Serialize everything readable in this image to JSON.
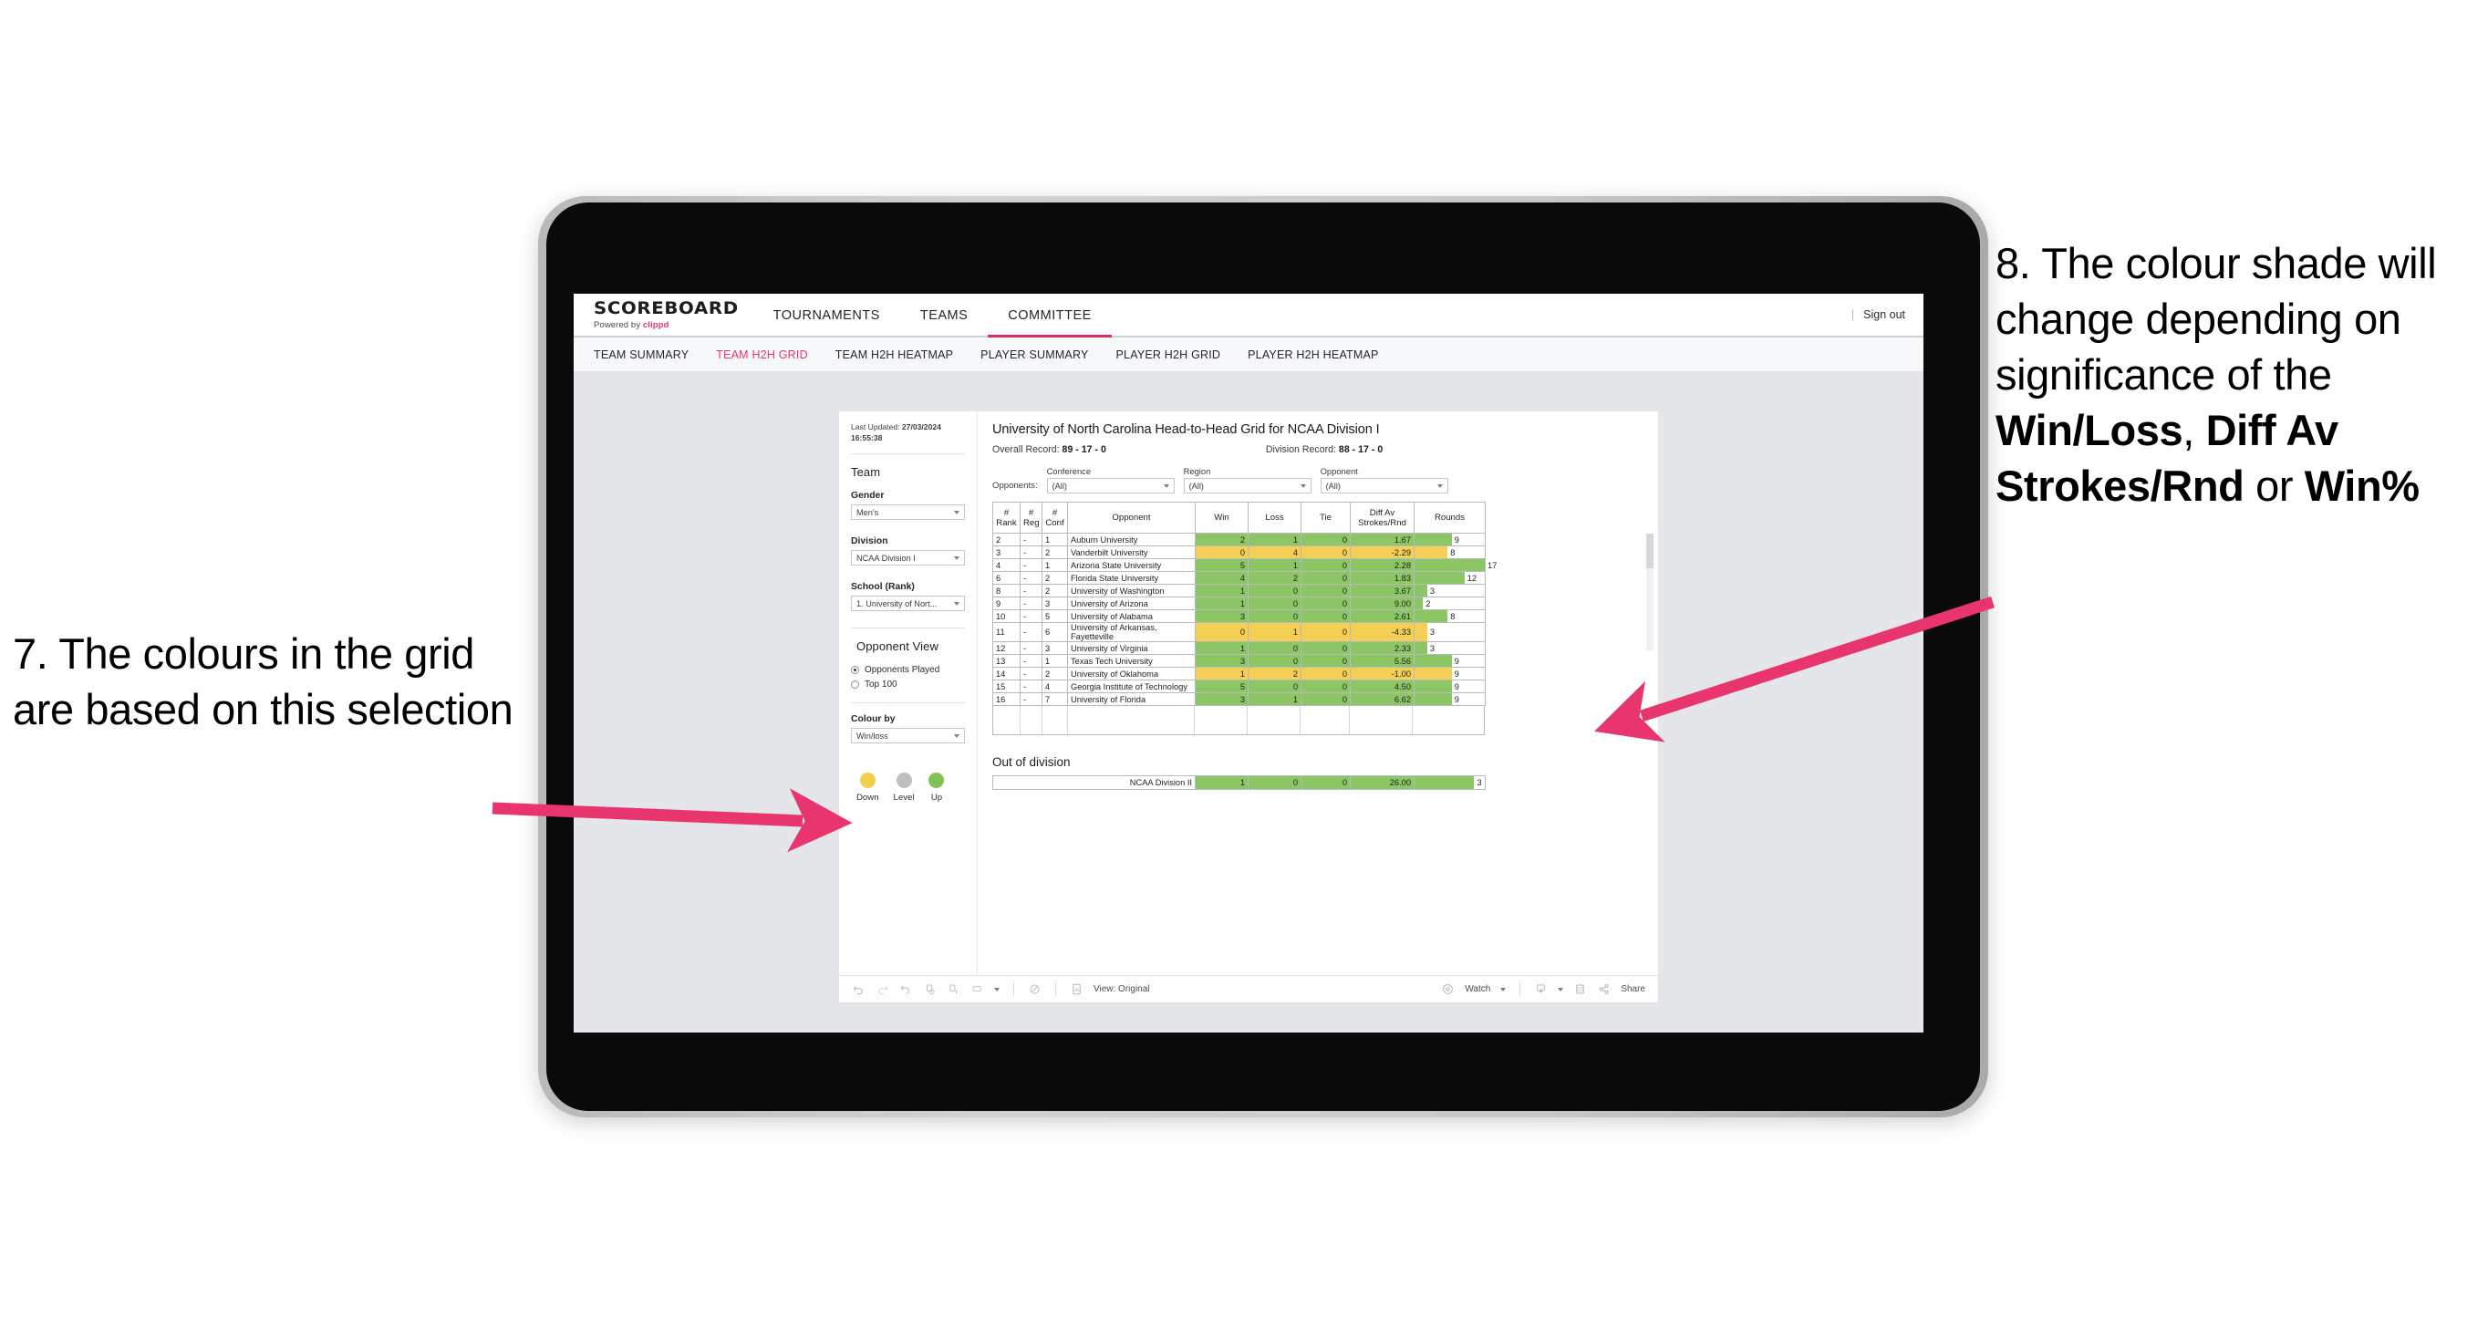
{
  "annotations": {
    "left": "7. The colours in the grid are based on this selection",
    "right_pre": "8. The colour shade will change depending on significance of the ",
    "right_b1": "Win/Loss",
    "right_mid1": ", ",
    "right_b2": "Diff Av Strokes/Rnd",
    "right_mid2": " or ",
    "right_b3": "Win%",
    "arrow_color": "#e8356d"
  },
  "app": {
    "brand": {
      "title": "SCOREBOARD",
      "powered_prefix": "Powered by ",
      "powered_brand": "clippd"
    },
    "topnav": [
      {
        "label": "TOURNAMENTS",
        "active": false
      },
      {
        "label": "TEAMS",
        "active": false
      },
      {
        "label": "COMMITTEE",
        "active": true
      }
    ],
    "topbar_right": {
      "divider": "|",
      "signout": "Sign out"
    },
    "subnav": [
      {
        "label": "TEAM SUMMARY",
        "active": false
      },
      {
        "label": "TEAM H2H GRID",
        "active": true
      },
      {
        "label": "TEAM H2H HEATMAP",
        "active": false
      },
      {
        "label": "PLAYER SUMMARY",
        "active": false
      },
      {
        "label": "PLAYER H2H GRID",
        "active": false
      },
      {
        "label": "PLAYER H2H HEATMAP",
        "active": false
      }
    ],
    "accent": "#e5376f"
  },
  "sidebar": {
    "last_updated_label": "Last Updated: ",
    "last_updated_value": "27/03/2024 16:55:38",
    "team_heading": "Team",
    "gender": {
      "label": "Gender",
      "value": "Men's"
    },
    "division": {
      "label": "Division",
      "value": "NCAA Division I"
    },
    "school": {
      "label": "School (Rank)",
      "value": "1. University of Nort..."
    },
    "opponent_view": {
      "heading": "Opponent View",
      "options": [
        {
          "label": "Opponents Played",
          "selected": true
        },
        {
          "label": "Top 100",
          "selected": false
        }
      ]
    },
    "colour_by": {
      "label": "Colour by",
      "value": "Win/loss"
    },
    "legend": [
      {
        "label": "Down",
        "color": "#f2cf4a"
      },
      {
        "label": "Level",
        "color": "#bdbec2"
      },
      {
        "label": "Up",
        "color": "#81c254"
      }
    ]
  },
  "main": {
    "title": "University of North Carolina Head-to-Head Grid for NCAA Division I",
    "overall_label": "Overall Record: ",
    "overall_value": "89 - 17 - 0",
    "division_label": "Division Record: ",
    "division_value": "88 - 17 - 0",
    "opponents_label": "Opponents:",
    "filters": [
      {
        "label": "Conference",
        "value": "(All)"
      },
      {
        "label": "Region",
        "value": "(All)"
      },
      {
        "label": "Opponent",
        "value": "(All)"
      }
    ],
    "out_of_division_title": "Out of division"
  },
  "chart_data": {
    "type": "table",
    "title": "University of North Carolina Head-to-Head Grid for NCAA Division I",
    "columns": [
      "# Rank",
      "# Reg",
      "# Conf",
      "Opponent",
      "Win",
      "Loss",
      "Tie",
      "Diff Av Strokes/Rnd",
      "Rounds"
    ],
    "column_headers_two_line": [
      [
        "#",
        "Rank"
      ],
      [
        "#",
        "Reg"
      ],
      [
        "#",
        "Conf"
      ],
      [
        "",
        "Opponent"
      ],
      [
        "",
        "Win"
      ],
      [
        "",
        "Loss"
      ],
      [
        "",
        "Tie"
      ],
      [
        "Diff Av",
        "Strokes/Rnd"
      ],
      [
        "",
        "Rounds"
      ]
    ],
    "rows": [
      {
        "rank": "2",
        "reg": "-",
        "conf": "1",
        "opponent": "Auburn University",
        "win": "2",
        "loss": "1",
        "tie": "0",
        "diff": "1.67",
        "rounds": "9",
        "rounds_pct": 53,
        "shade": "up"
      },
      {
        "rank": "3",
        "reg": "-",
        "conf": "2",
        "opponent": "Vanderbilt University",
        "win": "0",
        "loss": "4",
        "tie": "0",
        "diff": "-2.29",
        "rounds": "8",
        "rounds_pct": 47,
        "shade": "down"
      },
      {
        "rank": "4",
        "reg": "-",
        "conf": "1",
        "opponent": "Arizona State University",
        "win": "5",
        "loss": "1",
        "tie": "0",
        "diff": "2.28",
        "rounds": "17",
        "rounds_pct": 100,
        "shade": "up"
      },
      {
        "rank": "6",
        "reg": "-",
        "conf": "2",
        "opponent": "Florida State University",
        "win": "4",
        "loss": "2",
        "tie": "0",
        "diff": "1.83",
        "rounds": "12",
        "rounds_pct": 71,
        "shade": "up"
      },
      {
        "rank": "8",
        "reg": "-",
        "conf": "2",
        "opponent": "University of Washington",
        "win": "1",
        "loss": "0",
        "tie": "0",
        "diff": "3.67",
        "rounds": "3",
        "rounds_pct": 18,
        "shade": "up"
      },
      {
        "rank": "9",
        "reg": "-",
        "conf": "3",
        "opponent": "University of Arizona",
        "win": "1",
        "loss": "0",
        "tie": "0",
        "diff": "9.00",
        "rounds": "2",
        "rounds_pct": 12,
        "shade": "up"
      },
      {
        "rank": "10",
        "reg": "-",
        "conf": "5",
        "opponent": "University of Alabama",
        "win": "3",
        "loss": "0",
        "tie": "0",
        "diff": "2.61",
        "rounds": "8",
        "rounds_pct": 47,
        "shade": "up"
      },
      {
        "rank": "11",
        "reg": "-",
        "conf": "6",
        "opponent": "University of Arkansas, Fayetteville",
        "win": "0",
        "loss": "1",
        "tie": "0",
        "diff": "-4.33",
        "rounds": "3",
        "rounds_pct": 18,
        "shade": "down"
      },
      {
        "rank": "12",
        "reg": "-",
        "conf": "3",
        "opponent": "University of Virginia",
        "win": "1",
        "loss": "0",
        "tie": "0",
        "diff": "2.33",
        "rounds": "3",
        "rounds_pct": 18,
        "shade": "up"
      },
      {
        "rank": "13",
        "reg": "-",
        "conf": "1",
        "opponent": "Texas Tech University",
        "win": "3",
        "loss": "0",
        "tie": "0",
        "diff": "5.56",
        "rounds": "9",
        "rounds_pct": 53,
        "shade": "up"
      },
      {
        "rank": "14",
        "reg": "-",
        "conf": "2",
        "opponent": "University of Oklahoma",
        "win": "1",
        "loss": "2",
        "tie": "0",
        "diff": "-1.00",
        "rounds": "9",
        "rounds_pct": 53,
        "shade": "down"
      },
      {
        "rank": "15",
        "reg": "-",
        "conf": "4",
        "opponent": "Georgia Institute of Technology",
        "win": "5",
        "loss": "0",
        "tie": "0",
        "diff": "4.50",
        "rounds": "9",
        "rounds_pct": 53,
        "shade": "up"
      },
      {
        "rank": "16",
        "reg": "-",
        "conf": "7",
        "opponent": "University of Florida",
        "win": "3",
        "loss": "1",
        "tie": "0",
        "diff": "6.62",
        "rounds": "9",
        "rounds_pct": 53,
        "shade": "up"
      }
    ],
    "out_of_division": [
      {
        "opponent": "NCAA Division II",
        "win": "1",
        "loss": "0",
        "tie": "0",
        "diff": "26.00",
        "rounds": "3",
        "rounds_pct": 85,
        "shade": "up"
      }
    ],
    "colors": {
      "up": "#8cc665",
      "down": "#f3cf53",
      "level": "#bdbec2"
    }
  },
  "toolbar": {
    "view_label": "View: Original",
    "watch_label": "Watch",
    "share_label": "Share"
  }
}
